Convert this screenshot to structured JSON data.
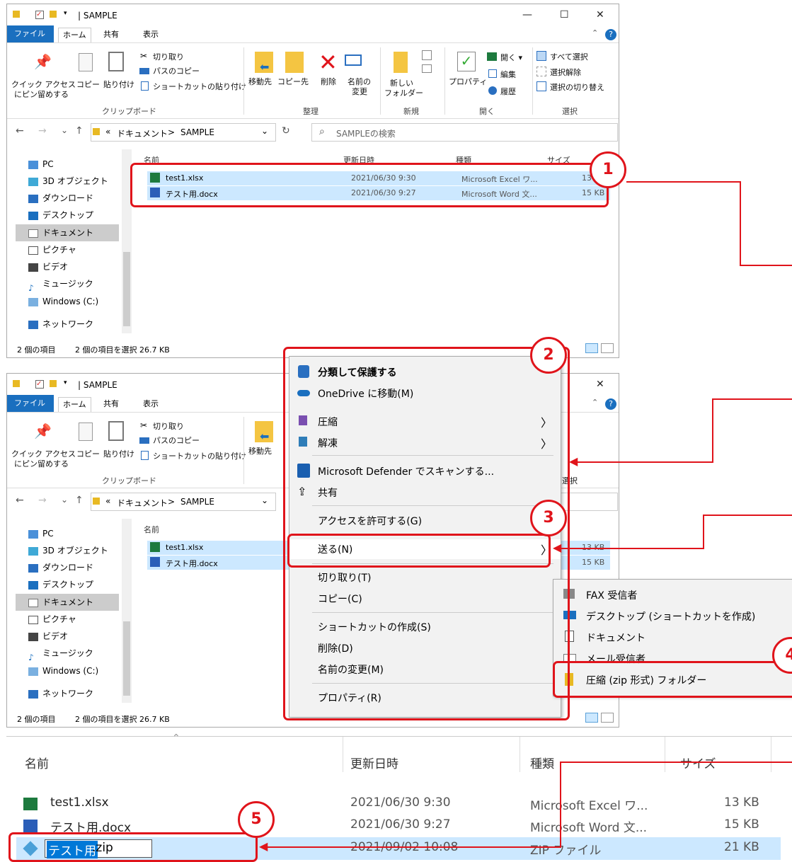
{
  "window": {
    "title": "SAMPLE",
    "title_sep": "| ",
    "controls": {
      "minimize": "—",
      "maximize": "☐",
      "close": "✕"
    }
  },
  "tabs": [
    "ファイル",
    "ホーム",
    "共有",
    "表示"
  ],
  "ribbon": {
    "pin_l1": "クイック アクセス",
    "pin_l2": "にピン留めする",
    "copy": "コピー",
    "paste": "貼り付け",
    "cut": "切り取り",
    "copy_path": "パスのコピー",
    "paste_shortcut": "ショートカットの貼り付け",
    "clipboard": "クリップボード",
    "move_to": "移動先",
    "copy_to": "コピー先",
    "delete": "削除",
    "rename_l1": "名前の",
    "rename_l2": "変更",
    "organize": "整理",
    "new_folder_l1": "新しい",
    "new_folder_l2": "フォルダー",
    "new": "新規",
    "properties": "プロパティ",
    "open": "開く ▾",
    "edit": "編集",
    "history": "履歴",
    "open_group": "開く",
    "select_all": "すべて選択",
    "select_none": "選択解除",
    "invert": "選択の切り替え",
    "select_group": "選択"
  },
  "address": {
    "nav_back": "←",
    "nav_forward": "→",
    "nav_recent": "⌄",
    "nav_up": "↑",
    "prefix": "«",
    "folder1": "ドキュメント",
    "arrow": ">",
    "folder2": "SAMPLE",
    "dropdown": "⌄",
    "refresh": "↻",
    "search_icon": "⌕",
    "search_placeholder": "SAMPLEの検索"
  },
  "nav_items": [
    "PC",
    "3D オブジェクト",
    "ダウンロード",
    "デスクトップ",
    "ドキュメント",
    "ピクチャ",
    "ビデオ",
    "ミュージック",
    "Windows (C:)",
    "ネットワーク"
  ],
  "columns": {
    "name": "名前",
    "date": "更新日時",
    "type": "種類",
    "size": "サイズ"
  },
  "files": [
    {
      "name": "test1.xlsx",
      "date": "2021/06/30 9:30",
      "type": "Microsoft Excel ワ...",
      "size": "13 KB"
    },
    {
      "name": "テスト用.docx",
      "date": "2021/06/30 9:27",
      "type": "Microsoft Word 文...",
      "size": "15 KB"
    }
  ],
  "file2_partial_sizes": [
    "13 KB",
    "15 KB"
  ],
  "status": {
    "count": "2 個の項目",
    "selected": "2 個の項目を選択  26.7 KB"
  },
  "context_menu": {
    "classify": "分類して保護する",
    "onedrive": "OneDrive に移動(M)",
    "compress": "圧縮",
    "extract": "解凍",
    "defender": "Microsoft Defender でスキャンする...",
    "share": "共有",
    "grant_access": "アクセスを許可する(G)",
    "send_to": "送る(N)",
    "cut": "切り取り(T)",
    "copy": "コピー(C)",
    "create_shortcut": "ショートカットの作成(S)",
    "delete": "削除(D)",
    "rename": "名前の変更(M)",
    "properties": "プロパティ(R)",
    "chevron": "〉"
  },
  "submenu": {
    "fax": "FAX 受信者",
    "desktop": "デスクトップ (ショートカットを作成)",
    "documents": "ドキュメント",
    "mail": "メール受信者",
    "zip": "圧縮 (zip 形式) フォルダー"
  },
  "bottom": {
    "columns": {
      "name": "名前",
      "date": "更新日時",
      "type": "種類",
      "size": "サイズ"
    },
    "files": [
      {
        "name": "test1.xlsx",
        "date": "2021/06/30 9:30",
        "type": "Microsoft Excel ワ...",
        "size": "13 KB"
      },
      {
        "name": "テスト用.docx",
        "date": "2021/06/30 9:27",
        "type": "Microsoft Word 文...",
        "size": "15 KB"
      }
    ],
    "new_name_selected": "テスト用",
    "new_name_rest": ".zip",
    "new_date": "2021/09/02 10:08",
    "new_type": "ZIP ファイル",
    "new_size": "21 KB"
  },
  "callouts": [
    "1",
    "2",
    "3",
    "4",
    "5"
  ],
  "colors": {
    "accent": "#1a6fbf",
    "selection": "#cce8ff",
    "callout_red": "#e0141b"
  }
}
